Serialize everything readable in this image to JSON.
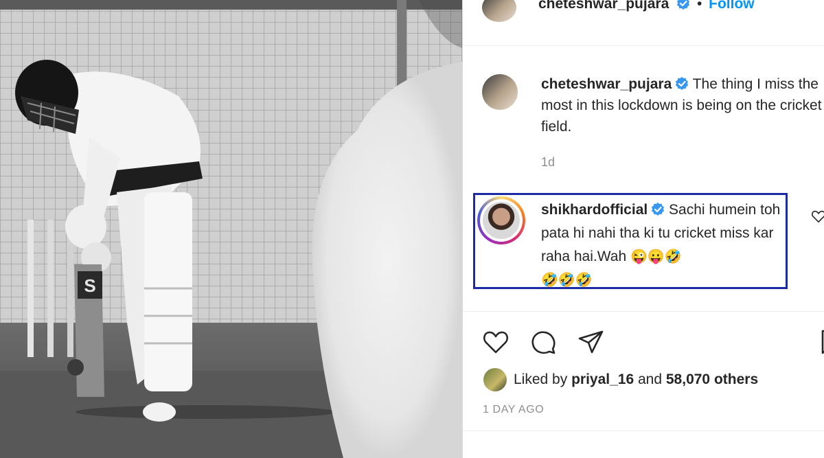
{
  "post": {
    "username": "cheteshwar_pujara",
    "follow_label": "Follow",
    "separator": "•"
  },
  "caption": {
    "username": "cheteshwar_pujara",
    "text": "The thing I miss the most in this lockdown is being on the cricket field.",
    "time": "1d"
  },
  "comment": {
    "username": "shikhardofficial",
    "text": "Sachi humein toh pata hi nahi tha ki tu cricket miss kar raha hai.Wah",
    "emojis_line1": "😜😛🤣",
    "emojis_line2": "🤣🤣🤣",
    "highlight_color": "#1b2aa6"
  },
  "likes": {
    "prefix": "Liked by",
    "user": "priyal_16",
    "connector": "and",
    "others": "58,070 others"
  },
  "timestamp": "1 DAY AGO",
  "icons": {
    "verified": "verified-badge-icon",
    "like": "heart-icon",
    "comment": "comment-bubble-icon",
    "share": "paper-plane-icon",
    "save": "bookmark-icon",
    "comment_like": "small-heart-icon"
  },
  "colors": {
    "link": "#0095f6",
    "verified": "#3897f0",
    "muted": "#8e8e8e",
    "text": "#262626"
  }
}
